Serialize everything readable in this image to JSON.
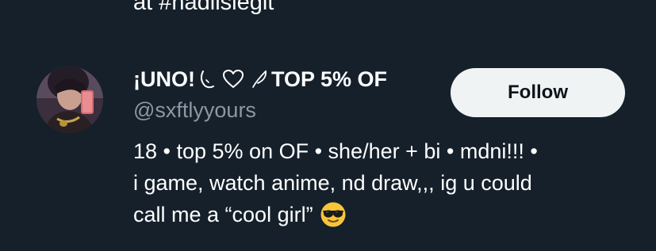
{
  "previous_tweet": {
    "tail_text": "at #nadiislegit"
  },
  "user": {
    "name_part1": "¡UNO!",
    "name_part2": "TOP 5% OF",
    "handle": "@sxftlyyours",
    "follow_label": "Follow",
    "bio_lines": [
      "18 • top 5% on OF • she/her + bi • mdni!!! •",
      "i game, watch anime, nd draw,,, ig u could",
      "call me a “cool girl”"
    ],
    "name_icons": [
      "moon-icon",
      "heart-outline-icon",
      "feather-icon"
    ],
    "bio_emoji": "sunglasses-face-icon"
  },
  "colors": {
    "background": "#15202b",
    "primary_text": "#ffffff",
    "secondary_text": "#8b98a5",
    "follow_button_bg": "#eff3f4",
    "follow_button_text": "#0f1419"
  }
}
